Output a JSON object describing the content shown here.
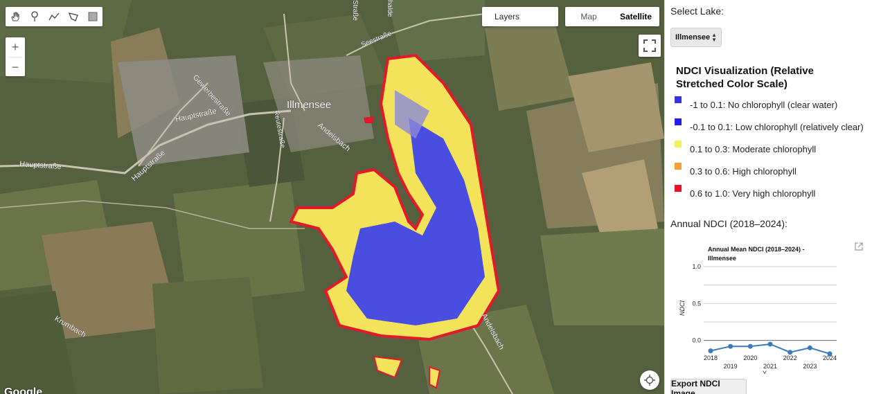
{
  "map": {
    "toolbar": [
      {
        "name": "hand-tool",
        "icon": "hand-icon"
      },
      {
        "name": "point-tool",
        "icon": "pin-icon"
      },
      {
        "name": "line-tool",
        "icon": "polyline-icon"
      },
      {
        "name": "polygon-tool",
        "icon": "polygon-icon"
      },
      {
        "name": "rectangle-tool",
        "icon": "rectangle-icon"
      }
    ],
    "zoom_in": "+",
    "zoom_out": "−",
    "layers_label": "Layers",
    "map_type_map": "Map",
    "map_type_satellite": "Satellite",
    "google_logo": "Google",
    "place_labels": {
      "town": "Illmensee",
      "gewerbe": "Gewerbestraße",
      "haupt1": "Hauptstraße",
      "haupt2": "Hauptstraße",
      "haupt3": "Hauptstraße",
      "reute": "Reutestraße",
      "andels1": "Andelsbach",
      "andels2": "Andelsbach",
      "krum": "Krumbach",
      "see": "Seestraße",
      "top1": "Straße",
      "top2": "halde"
    }
  },
  "panel": {
    "select_label": "Select Lake:",
    "lake_value": "Illmensee",
    "legend_title": "NDCI Visualization (Relative Stretched Color Scale)",
    "legend": [
      {
        "label": "-1 to 0.1: No chlorophyll (clear water)",
        "color": "#3535e6"
      },
      {
        "label": "-0.1 to 0.1: Low chlorophyll (relatively clear)",
        "color": "#1e1ef5"
      },
      {
        "label": "0.1 to 0.3: Moderate chlorophyll",
        "color": "#f5f05a"
      },
      {
        "label": "0.3 to 0.6: High chlorophyll",
        "color": "#f5a030"
      },
      {
        "label": "0.6 to 1.0: Very high chlorophyll",
        "color": "#e8102a"
      }
    ],
    "annual_label": "Annual NDCI (2018–2024):",
    "export_label": "Export NDCI Image"
  },
  "chart_data": {
    "type": "line",
    "title": "Annual Mean NDCI (2018–2024) - Illmensee",
    "xlabel": "Y",
    "ylabel": "NDCI",
    "x": [
      2018,
      2019,
      2020,
      2021,
      2022,
      2023,
      2024
    ],
    "series": [
      {
        "values": [
          -0.14,
          -0.08,
          -0.08,
          -0.05,
          -0.16,
          -0.1,
          -0.18
        ],
        "color": "#3a7ab8"
      }
    ],
    "ylim": [
      -0.2,
      1.0
    ],
    "yticks": [
      "0.0",
      "0.5",
      "1.0"
    ],
    "xticks": [
      "2018",
      "2019",
      "2020",
      "2021",
      "2022",
      "2023",
      "2024"
    ],
    "grid": true
  }
}
